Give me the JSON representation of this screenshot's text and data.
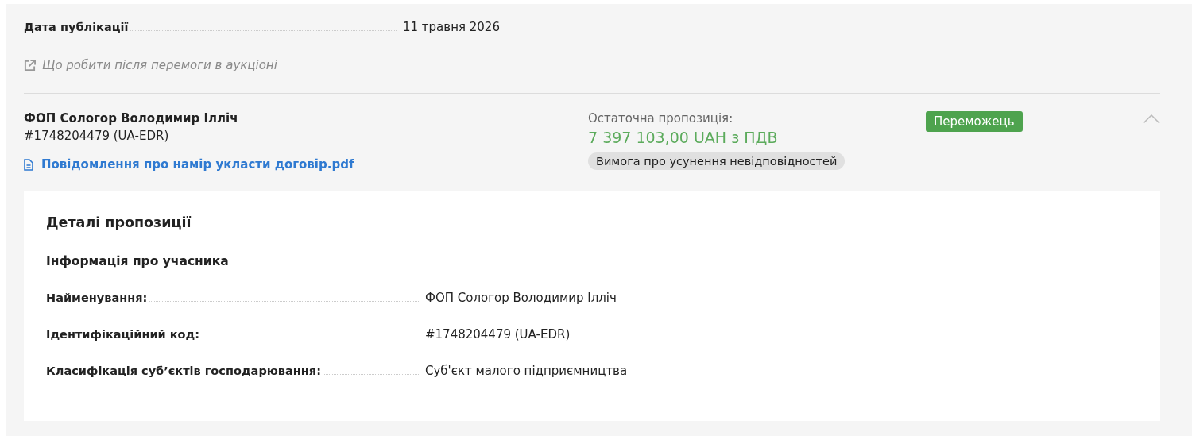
{
  "publication": {
    "label": "Дата публікації",
    "value": "11 травня 2026"
  },
  "help_link": "Що робити після перемоги в аукціоні",
  "bid": {
    "name": "ФОП Сологор Володимир Ілліч",
    "code": "#1748204479 (UA-EDR)",
    "document": "Повідомлення про намір укласти договір.pdf",
    "final_label": "Остаточна пропозиція:",
    "amount": "7 397 103,00 UAH з ПДВ",
    "requirement": "Вимога про усунення невідповідностей",
    "status": "Переможець",
    "expanded": true
  },
  "details": {
    "title": "Деталі пропозиції",
    "section": "Інформація про учасника",
    "rows": [
      {
        "label": "Найменування:",
        "value": "ФОП Сологор Володимир Ілліч"
      },
      {
        "label": "Ідентифікаційний код:",
        "value": "#1748204479 (UA-EDR)"
      },
      {
        "label": "Класифікація суб’єктів господарювання:",
        "value": "Суб'єкт малого підприємництва"
      }
    ]
  }
}
